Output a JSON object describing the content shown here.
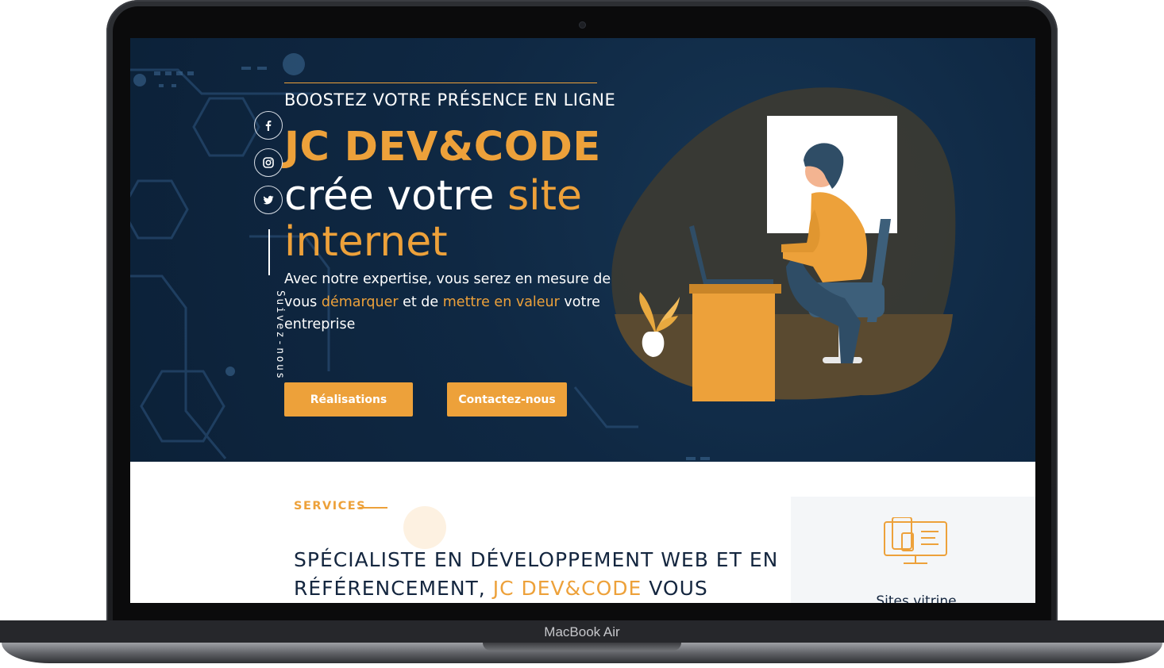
{
  "device": {
    "label": "MacBook Air"
  },
  "hero": {
    "tagline": "BOOSTEZ VOTRE PRÉSENCE EN LIGNE",
    "brand": "JC DEV&CODE",
    "headline": {
      "part1": "crée votre ",
      "accent": "site internet"
    },
    "lead": {
      "part1": "Avec notre expertise, vous serez en mesure de vous ",
      "accent1": "démarquer",
      "part2": " et de ",
      "accent2": "mettre en valeur",
      "part3": " votre entreprise"
    },
    "buttons": {
      "realisations": "Réalisations",
      "contact": "Contactez-nous"
    },
    "social": {
      "follow_label": "Suivez-nous",
      "items": [
        "facebook-icon",
        "instagram-icon",
        "twitter-icon"
      ]
    }
  },
  "services": {
    "eyebrow": "SERVICES",
    "heading": {
      "part1": "SPÉCIALISTE EN DÉVELOPPEMENT WEB ET EN RÉFÉRENCEMENT, ",
      "accent": "JC DEV&CODE",
      "part2": " VOUS"
    },
    "card": {
      "title": "Sites vitrine",
      "icon": "monitor-devices-icon"
    }
  },
  "colors": {
    "accent": "#eda13a",
    "navy": "#0f2843",
    "text_dark": "#14263f"
  }
}
